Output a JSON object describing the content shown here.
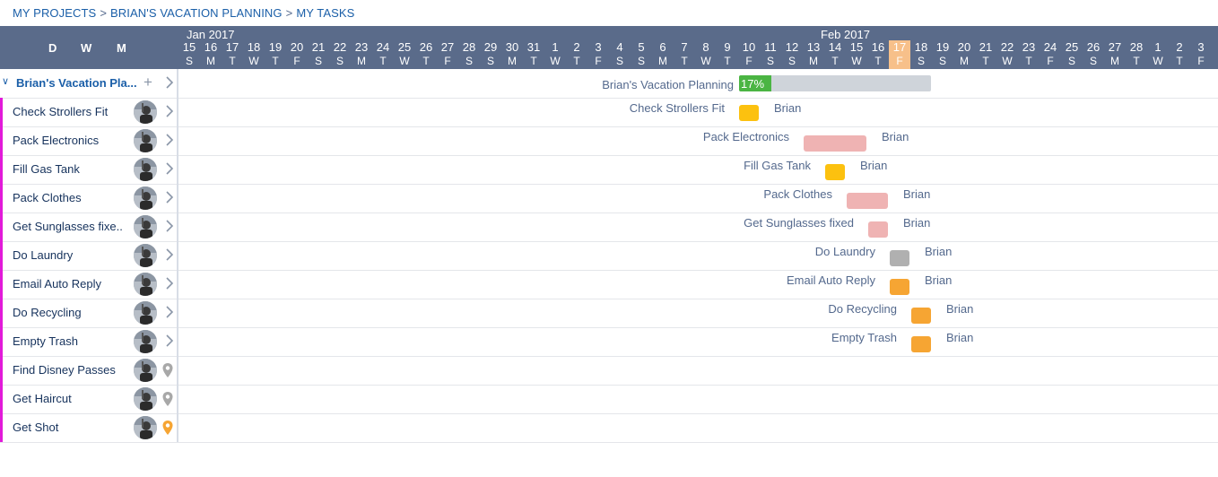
{
  "breadcrumb": [
    "MY PROJECTS",
    "BRIAN'S VACATION PLANNING",
    "MY TASKS"
  ],
  "breadcrumb_sep": ">",
  "zoom": [
    "D",
    "W",
    "M"
  ],
  "months": [
    "Jan 2017",
    "Feb 2017"
  ],
  "days": [
    {
      "n": "15",
      "l": "S"
    },
    {
      "n": "16",
      "l": "M"
    },
    {
      "n": "17",
      "l": "T"
    },
    {
      "n": "18",
      "l": "W"
    },
    {
      "n": "19",
      "l": "T"
    },
    {
      "n": "20",
      "l": "F"
    },
    {
      "n": "21",
      "l": "S"
    },
    {
      "n": "22",
      "l": "S"
    },
    {
      "n": "23",
      "l": "M"
    },
    {
      "n": "24",
      "l": "T"
    },
    {
      "n": "25",
      "l": "W"
    },
    {
      "n": "26",
      "l": "T"
    },
    {
      "n": "27",
      "l": "F"
    },
    {
      "n": "28",
      "l": "S"
    },
    {
      "n": "29",
      "l": "S"
    },
    {
      "n": "30",
      "l": "M"
    },
    {
      "n": "31",
      "l": "T"
    },
    {
      "n": "1",
      "l": "W"
    },
    {
      "n": "2",
      "l": "T"
    },
    {
      "n": "3",
      "l": "F"
    },
    {
      "n": "4",
      "l": "S"
    },
    {
      "n": "5",
      "l": "S"
    },
    {
      "n": "6",
      "l": "M"
    },
    {
      "n": "7",
      "l": "T"
    },
    {
      "n": "8",
      "l": "W"
    },
    {
      "n": "9",
      "l": "T"
    },
    {
      "n": "10",
      "l": "F"
    },
    {
      "n": "11",
      "l": "S"
    },
    {
      "n": "12",
      "l": "S"
    },
    {
      "n": "13",
      "l": "M"
    },
    {
      "n": "14",
      "l": "T"
    },
    {
      "n": "15",
      "l": "W"
    },
    {
      "n": "16",
      "l": "T"
    },
    {
      "n": "17",
      "l": "F"
    },
    {
      "n": "18",
      "l": "S"
    },
    {
      "n": "19",
      "l": "S"
    },
    {
      "n": "20",
      "l": "M"
    },
    {
      "n": "21",
      "l": "T"
    },
    {
      "n": "22",
      "l": "W"
    },
    {
      "n": "23",
      "l": "T"
    },
    {
      "n": "24",
      "l": "F"
    },
    {
      "n": "25",
      "l": "S"
    },
    {
      "n": "26",
      "l": "S"
    },
    {
      "n": "27",
      "l": "M"
    },
    {
      "n": "28",
      "l": "T"
    },
    {
      "n": "1",
      "l": "W"
    },
    {
      "n": "2",
      "l": "T"
    },
    {
      "n": "3",
      "l": "F"
    }
  ],
  "today": "Feb 17",
  "project": {
    "short_label": "Brian's Vacation Pla...",
    "bar_label": "Brian's Vacation Planning",
    "progress": "17%"
  },
  "tasks": [
    {
      "name": "Check Strollers Fit",
      "bar_label": "Check Strollers Fit",
      "owner": "Brian",
      "color": "#fcc10f",
      "icon": "chevron-right-icon"
    },
    {
      "name": "Pack Electronics",
      "bar_label": "Pack Electronics",
      "owner": "Brian",
      "color": "#efb3b3",
      "icon": "chevron-right-icon"
    },
    {
      "name": "Fill Gas Tank",
      "bar_label": "Fill Gas Tank",
      "owner": "Brian",
      "color": "#fcc10f",
      "icon": "chevron-right-icon"
    },
    {
      "name": "Pack Clothes",
      "bar_label": "Pack Clothes",
      "owner": "Brian",
      "color": "#efb3b3",
      "icon": "chevron-right-icon"
    },
    {
      "name": "Get Sunglasses fixe..",
      "bar_label": "Get Sunglasses fixed",
      "owner": "Brian",
      "color": "#efb3b3",
      "icon": "chevron-right-icon"
    },
    {
      "name": "Do Laundry",
      "bar_label": "Do Laundry",
      "owner": "Brian",
      "color": "#b0b0b0",
      "icon": "chevron-right-icon"
    },
    {
      "name": "Email Auto Reply",
      "bar_label": "Email Auto Reply",
      "owner": "Brian",
      "color": "#f6a533",
      "icon": "chevron-right-icon"
    },
    {
      "name": "Do Recycling",
      "bar_label": "Do Recycling",
      "owner": "Brian",
      "color": "#f6a533",
      "icon": "chevron-right-icon"
    },
    {
      "name": "Empty Trash",
      "bar_label": "Empty Trash",
      "owner": "Brian",
      "color": "#f6a533",
      "icon": "chevron-right-icon"
    },
    {
      "name": "Find Disney Passes",
      "icon": "location-pin-icon",
      "pin_color": "#a8a8a8"
    },
    {
      "name": "Get Haircut",
      "icon": "location-pin-icon",
      "pin_color": "#a8a8a8"
    },
    {
      "name": "Get Shot",
      "icon": "location-pin-icon",
      "pin_color": "#f6a533"
    }
  ],
  "colors": {
    "header": "#5a6b8a",
    "today": "#f7c08a",
    "stripe": "#e21ad9",
    "progress": "#4bb543",
    "link": "#1b5fa8"
  }
}
